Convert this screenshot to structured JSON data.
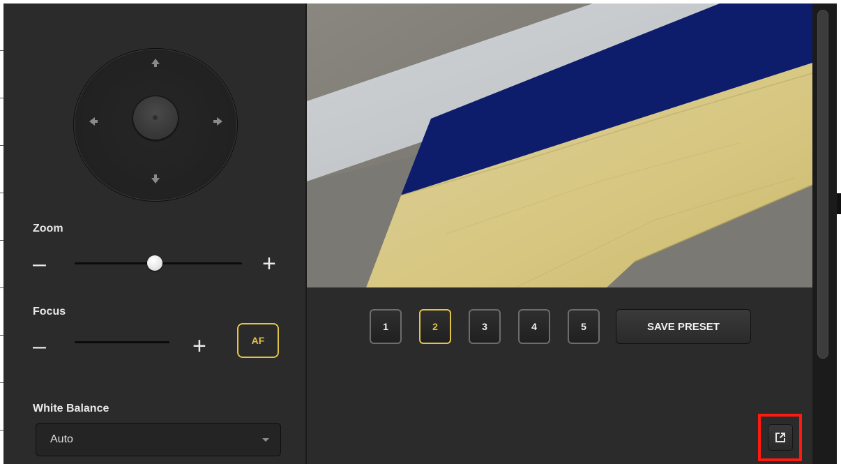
{
  "ptz": {
    "zoom": {
      "label": "Zoom",
      "minus": "–",
      "plus": "+",
      "level": 0.48
    },
    "focus": {
      "label": "Focus",
      "minus": "–",
      "plus": "+",
      "af_label": "AF"
    },
    "white_balance": {
      "label": "White Balance",
      "value": "Auto"
    }
  },
  "presets": {
    "buttons": [
      "1",
      "2",
      "3",
      "4",
      "5"
    ],
    "active": "2",
    "save_label": "SAVE PRESET"
  },
  "colors": {
    "accent": "#e3c34a",
    "highlight": "#ff1a0d",
    "panel": "#2b2b2b",
    "flag_blue": "#0d1d6b",
    "flag_yellow": "#d9c98a"
  },
  "icons": {
    "joystick": [
      "arrow-up-icon",
      "arrow-down-icon",
      "arrow-left-icon",
      "arrow-right-icon"
    ],
    "popout": "popout-icon"
  }
}
